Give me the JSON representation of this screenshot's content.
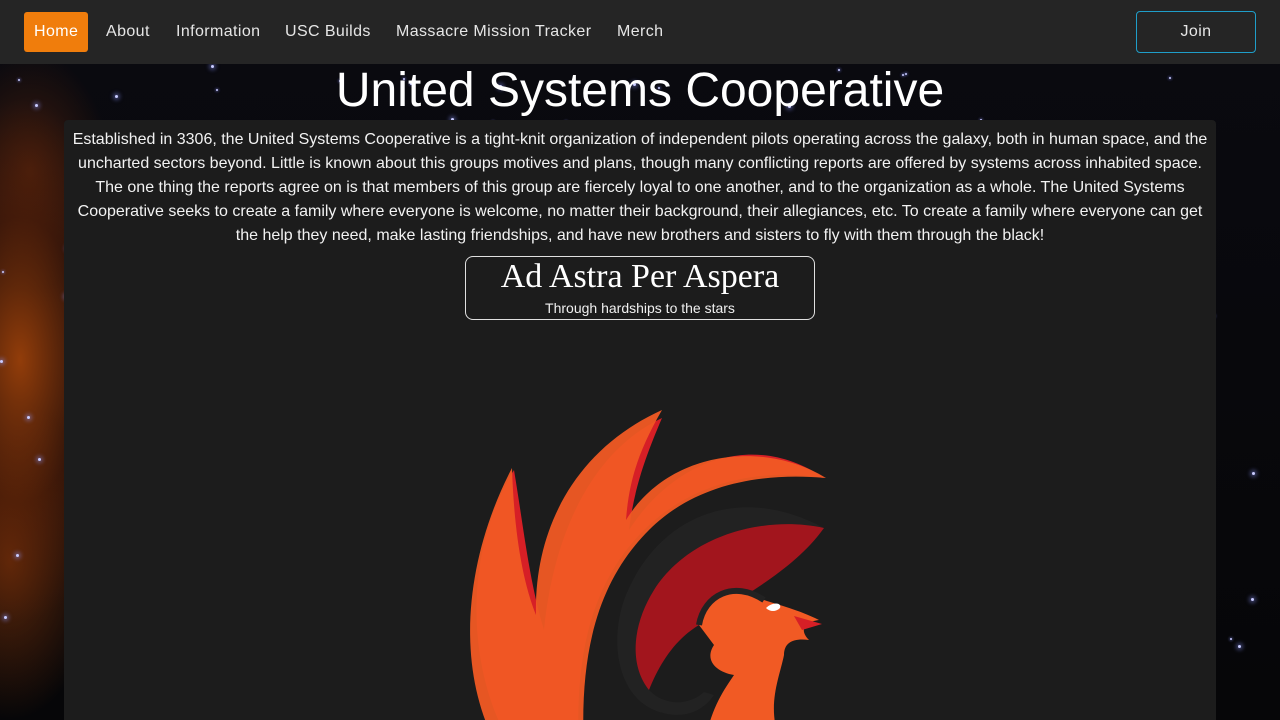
{
  "nav": {
    "items": [
      {
        "label": "Home",
        "active": true
      },
      {
        "label": "About",
        "active": false
      },
      {
        "label": "Information",
        "active": false
      },
      {
        "label": "USC Builds",
        "active": false
      },
      {
        "label": "Massacre Mission Tracker",
        "active": false
      },
      {
        "label": "Merch",
        "active": false
      }
    ],
    "join_label": "Join"
  },
  "page": {
    "title": "United Systems Cooperative",
    "intro": "Established in 3306, the United Systems Cooperative is a tight-knit organization of independent pilots operating across the galaxy, both in human space, and the uncharted sectors beyond. Little is known about this groups motives and plans, though many conflicting reports are offered by systems across inhabited space. The one thing the reports agree on is that members of this group are fiercely loyal to one another, and to the organization as a whole. The United Systems Cooperative seeks to create a family where everyone is welcome, no matter their background, their allegiances, etc. To create a family where everyone can get the help they need, make lasting friendships, and have new brothers and sisters to fly with them through the black!",
    "motto": {
      "latin": "Ad Astra Per Aspera",
      "english": "Through hardships to the stars"
    }
  },
  "colors": {
    "accent": "#f07d0c",
    "join_border": "#1f9ec9",
    "navbar_bg": "#252525",
    "card_bg": "#1c1c1c"
  },
  "logo": {
    "icon": "phoenix-logo-icon"
  }
}
